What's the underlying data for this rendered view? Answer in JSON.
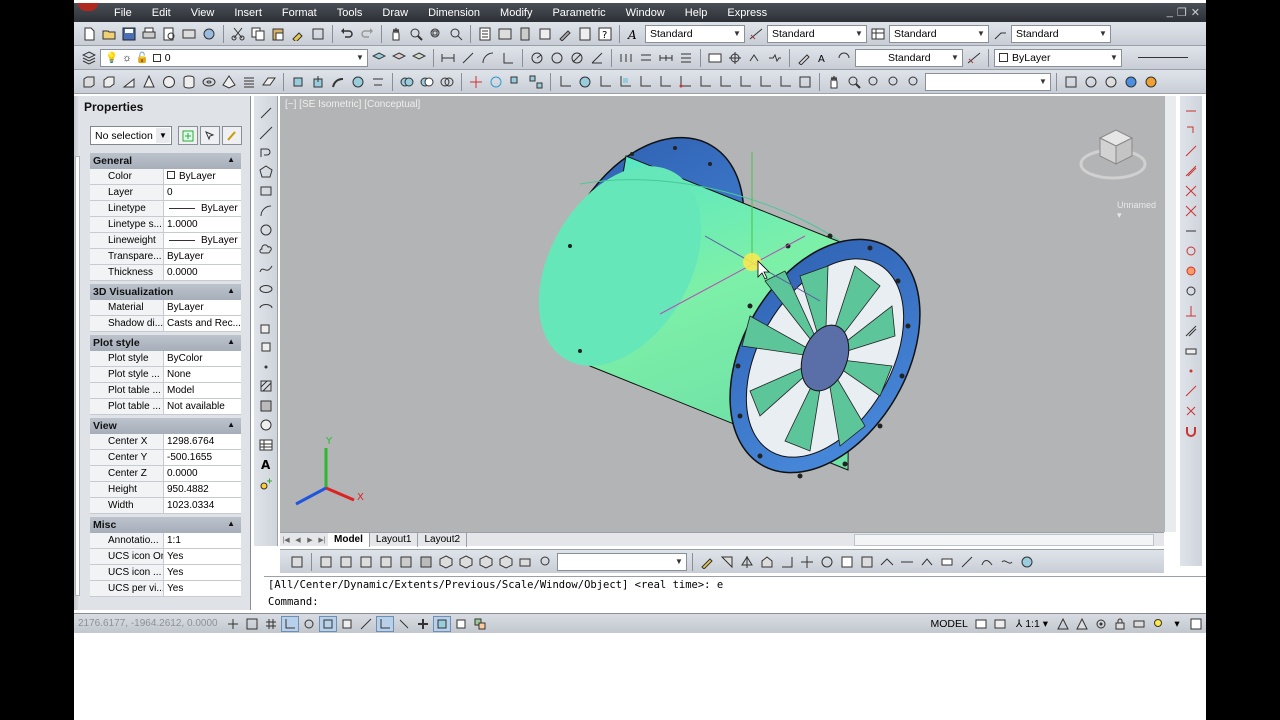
{
  "menu": [
    "File",
    "Edit",
    "View",
    "Insert",
    "Format",
    "Tools",
    "Draw",
    "Dimension",
    "Modify",
    "Parametric",
    "Window",
    "Help",
    "Express"
  ],
  "toolbar1": {
    "text_style": "Standard",
    "dim_style": "Standard",
    "table_style": "Standard",
    "mleader_style": "Standard"
  },
  "toolbar2": {
    "layer": "0",
    "visual_style": "Standard",
    "color": "ByLayer"
  },
  "properties": {
    "title": "Properties",
    "selection": "No selection",
    "sections": [
      {
        "name": "General",
        "rows": [
          {
            "k": "Color",
            "v": "ByLayer"
          },
          {
            "k": "Layer",
            "v": "0"
          },
          {
            "k": "Linetype",
            "v": "ByLayer"
          },
          {
            "k": "Linetype s...",
            "v": "1.0000"
          },
          {
            "k": "Lineweight",
            "v": "ByLayer"
          },
          {
            "k": "Transpare...",
            "v": "ByLayer"
          },
          {
            "k": "Thickness",
            "v": "0.0000"
          }
        ]
      },
      {
        "name": "3D Visualization",
        "rows": [
          {
            "k": "Material",
            "v": "ByLayer"
          },
          {
            "k": "Shadow di...",
            "v": "Casts and Rec..."
          }
        ]
      },
      {
        "name": "Plot style",
        "rows": [
          {
            "k": "Plot style",
            "v": "ByColor"
          },
          {
            "k": "Plot style ...",
            "v": "None"
          },
          {
            "k": "Plot table ...",
            "v": "Model"
          },
          {
            "k": "Plot table ...",
            "v": "Not available"
          }
        ]
      },
      {
        "name": "View",
        "rows": [
          {
            "k": "Center X",
            "v": "1298.6764"
          },
          {
            "k": "Center Y",
            "v": "-500.1655"
          },
          {
            "k": "Center Z",
            "v": "0.0000"
          },
          {
            "k": "Height",
            "v": "950.4882"
          },
          {
            "k": "Width",
            "v": "1023.0334"
          }
        ]
      },
      {
        "name": "Misc",
        "rows": [
          {
            "k": "Annotatio...",
            "v": "1:1"
          },
          {
            "k": "UCS icon On",
            "v": "Yes"
          },
          {
            "k": "UCS icon ...",
            "v": "Yes"
          },
          {
            "k": "UCS per vi...",
            "v": "Yes"
          }
        ]
      }
    ]
  },
  "viewport": {
    "label": "[−] [SE Isometric] [Conceptual]",
    "viewcube_label": "Unnamed",
    "colors": {
      "duct": "#72f0b5",
      "flange": "#3f7fd0",
      "blade": "#5cc59a",
      "hub": "#5a6fa8",
      "background": "#b3b4b6"
    }
  },
  "tabs": [
    "Model",
    "Layout1",
    "Layout2"
  ],
  "active_tab": "Model",
  "command": {
    "history": "[All/Center/Dynamic/Extents/Previous/Scale/Window/Object] <real time>: e",
    "prompt": "Command:"
  },
  "status": {
    "coords": "2176.6177, -1964.2612, 0.0000",
    "space": "MODEL",
    "annotation_scale": "1:1"
  }
}
